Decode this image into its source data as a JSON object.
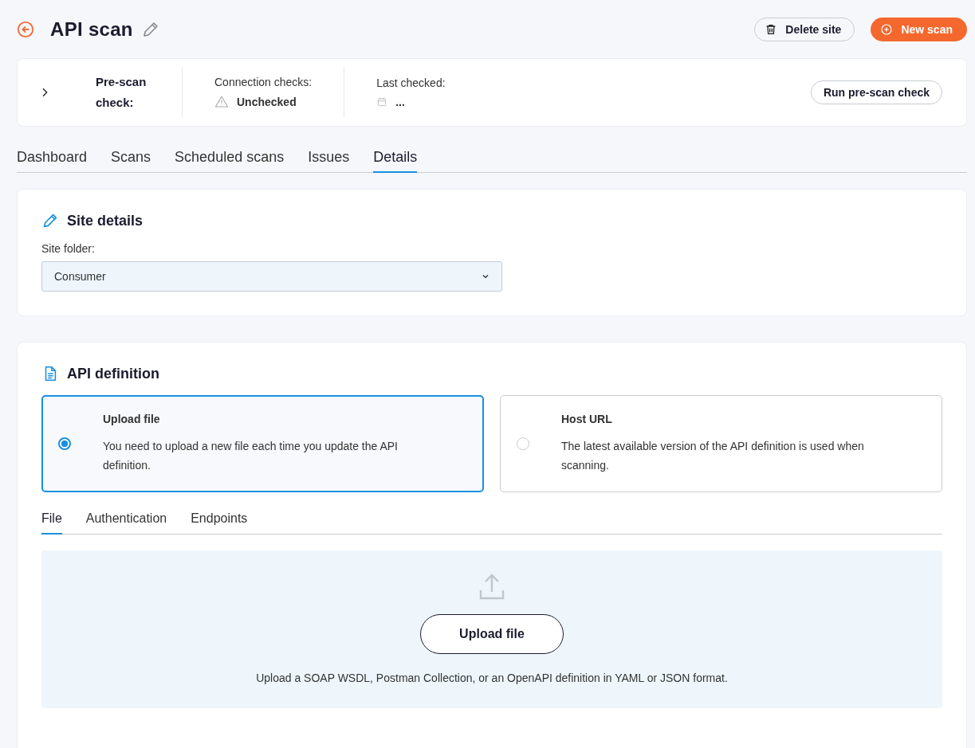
{
  "header": {
    "title": "API scan",
    "buttons": [
      {
        "kind": "outline",
        "label": "Delete site"
      },
      {
        "kind": "primary",
        "label": "New scan"
      }
    ]
  },
  "prescan": {
    "title": "Pre-scan check:",
    "expanded": false,
    "connection_label": "Connection checks:",
    "connection_value": "Unchecked",
    "last_label": "Last checked:",
    "last_value": "...",
    "button": "Run pre-scan check"
  },
  "tabs": [
    {
      "label": "Dashboard",
      "selected": false
    },
    {
      "label": "Scans",
      "selected": false
    },
    {
      "label": "Scheduled scans",
      "selected": false
    },
    {
      "label": "Issues",
      "selected": false
    },
    {
      "label": "Details",
      "selected": true
    }
  ],
  "site_details": {
    "title": "Site details",
    "folder_label": "Site folder:",
    "folder_value": "Consumer"
  },
  "api_definition": {
    "title": "API definition",
    "options": [
      {
        "title": "Upload file",
        "description": "You need to upload a new file each time you update the API definition.",
        "selected": true
      },
      {
        "title": "Host URL",
        "description": "The latest available version of the API definition is used when scanning.",
        "selected": false
      }
    ],
    "tabs": [
      {
        "label": "File",
        "selected": true
      },
      {
        "label": "Authentication",
        "selected": false
      },
      {
        "label": "Endpoints",
        "selected": false
      }
    ],
    "upload_button": "Upload file",
    "upload_hint": "Upload a SOAP WSDL, Postman Collection, or an OpenAPI definition in YAML or JSON format."
  }
}
